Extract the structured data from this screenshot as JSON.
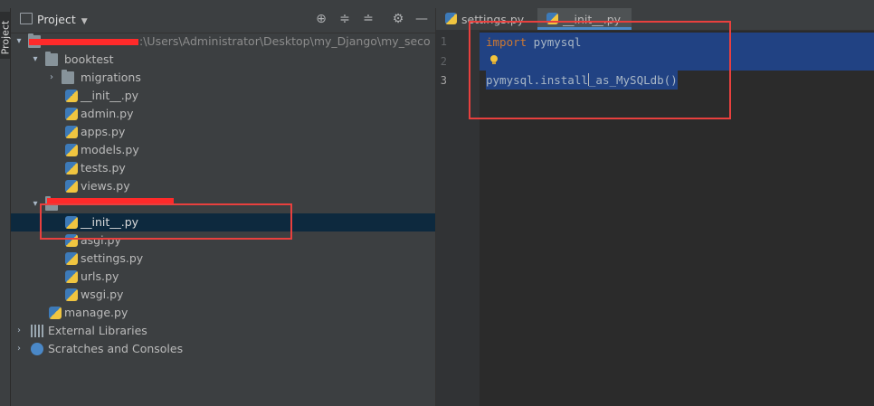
{
  "sidebar_tab": {
    "label": "Project"
  },
  "project_panel": {
    "title": "Project",
    "toolbar_icons": [
      "locate-icon",
      "expand-all-icon",
      "collapse-all-icon",
      "settings-icon",
      "hide-icon"
    ]
  },
  "tree": {
    "root": {
      "suffix": ":\\Users\\Administrator\\Desktop\\my_Django\\my_seco"
    },
    "booktest": {
      "label": "booktest"
    },
    "migrations": {
      "label": "migrations"
    },
    "booktest_init": {
      "label": "__init__.py"
    },
    "admin": {
      "label": "admin.py"
    },
    "apps": {
      "label": "apps.py"
    },
    "models": {
      "label": "models.py"
    },
    "tests": {
      "label": "tests.py"
    },
    "views": {
      "label": "views.py"
    },
    "pkg_init": {
      "label": "__init__.py"
    },
    "asgi": {
      "label": "asgi.py"
    },
    "settings": {
      "label": "settings.py"
    },
    "urls": {
      "label": "urls.py"
    },
    "wsgi": {
      "label": "wsgi.py"
    },
    "manage": {
      "label": "manage.py"
    },
    "external": {
      "label": "External Libraries"
    },
    "scratches": {
      "label": "Scratches and Consoles"
    }
  },
  "editor": {
    "tabs": [
      {
        "label": "settings.py"
      },
      {
        "label": "__init__.py"
      }
    ],
    "line_numbers": [
      "1",
      "2",
      "3"
    ],
    "code": {
      "line1_kw": "import",
      "line1_rest": " pymysql",
      "line3_pre": "pymysql.install",
      "line3_post": "_as_MySQLdb()"
    }
  }
}
